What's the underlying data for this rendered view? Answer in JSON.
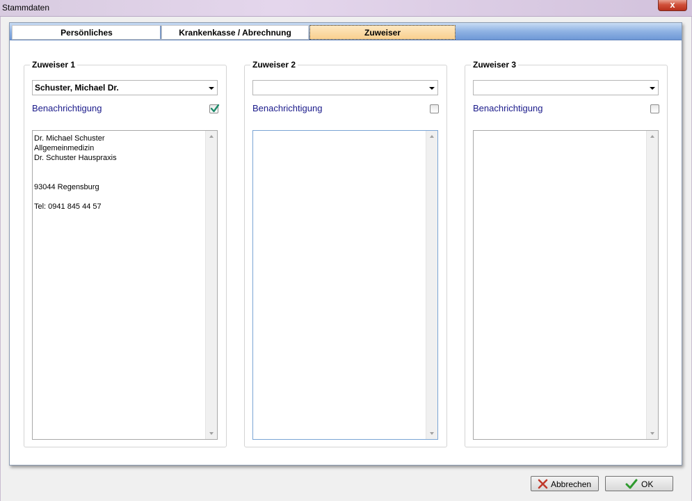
{
  "window": {
    "title": "Stammdaten",
    "close_label": "x"
  },
  "tabs": [
    {
      "label": "Persönliches",
      "active": false
    },
    {
      "label": "Krankenkasse / Abrechnung",
      "active": false
    },
    {
      "label": "Zuweiser",
      "active": true
    }
  ],
  "referrers": [
    {
      "title": "Zuweiser 1",
      "selected": "Schuster, Michael Dr.",
      "notify_label": "Benachrichtigung",
      "notify_checked": true,
      "address": "Dr. Michael Schuster\nAllgemeinmedizin\nDr. Schuster Hauspraxis\n\n\n93044 Regensburg\n\nTel: 0941 845 44 57"
    },
    {
      "title": "Zuweiser 2",
      "selected": "",
      "notify_label": "Benachrichtigung",
      "notify_checked": false,
      "address": ""
    },
    {
      "title": "Zuweiser 3",
      "selected": "",
      "notify_label": "Benachrichtigung",
      "notify_checked": false,
      "address": ""
    }
  ],
  "buttons": {
    "cancel_label": "Abbrechen",
    "ok_label": "OK"
  },
  "colors": {
    "tab_active": "#f9d08f",
    "tab_bar": "#8fb2e3",
    "link_text": "#1a1a8a",
    "check_mark": "#1e8a6a",
    "cancel_icon": "#c0392b",
    "ok_icon": "#2f9a2f"
  },
  "icons": {
    "close": "close-icon",
    "cancel": "cross-icon",
    "ok": "checkmark-icon",
    "dropdown": "chevron-down-icon"
  }
}
